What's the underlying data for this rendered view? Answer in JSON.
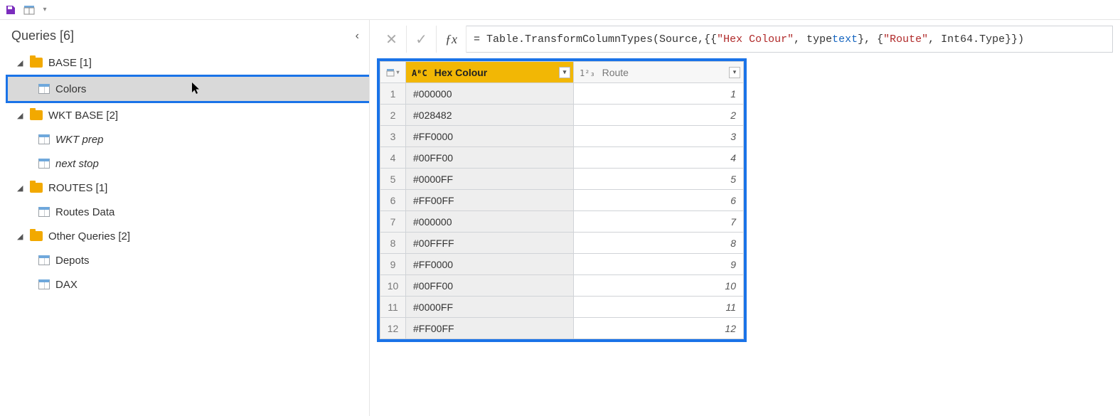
{
  "toolbar": {
    "save_icon": "save-icon",
    "table_icon": "table-icon",
    "dropdown_icon": "chevron-down-icon"
  },
  "sidebar": {
    "header": "Queries [6]",
    "groups": [
      {
        "name": "BASE [1]",
        "expanded": true,
        "items": [
          {
            "name": "Colors",
            "selected": true,
            "italic": false
          }
        ]
      },
      {
        "name": "WKT BASE [2]",
        "expanded": true,
        "items": [
          {
            "name": "WKT prep",
            "selected": false,
            "italic": true
          },
          {
            "name": "next stop",
            "selected": false,
            "italic": true
          }
        ]
      },
      {
        "name": "ROUTES [1]",
        "expanded": true,
        "items": [
          {
            "name": "Routes Data",
            "selected": false,
            "italic": false
          }
        ]
      },
      {
        "name": "Other Queries [2]",
        "expanded": true,
        "items": [
          {
            "name": "Depots",
            "selected": false,
            "italic": false
          },
          {
            "name": "DAX",
            "selected": false,
            "italic": false
          }
        ]
      }
    ]
  },
  "formula": {
    "prefix": "= Table.TransformColumnTypes(Source,{{",
    "str1": "\"Hex Colour\"",
    "mid1": ", type ",
    "kw1": "text",
    "mid2": "}, {",
    "str2": "\"Route\"",
    "mid3": ", Int64.Type}})"
  },
  "table": {
    "columns": [
      {
        "type_badge": "AᴮC",
        "label": "Hex Colour"
      },
      {
        "type_badge": "1²₃",
        "label": "Route"
      }
    ],
    "rows": [
      {
        "idx": "1",
        "hex": "#000000",
        "route": "1"
      },
      {
        "idx": "2",
        "hex": "#028482",
        "route": "2"
      },
      {
        "idx": "3",
        "hex": "#FF0000",
        "route": "3"
      },
      {
        "idx": "4",
        "hex": "#00FF00",
        "route": "4"
      },
      {
        "idx": "5",
        "hex": "#0000FF",
        "route": "5"
      },
      {
        "idx": "6",
        "hex": "#FF00FF",
        "route": "6"
      },
      {
        "idx": "7",
        "hex": "#000000",
        "route": "7"
      },
      {
        "idx": "8",
        "hex": "#00FFFF",
        "route": "8"
      },
      {
        "idx": "9",
        "hex": "#FF0000",
        "route": "9"
      },
      {
        "idx": "10",
        "hex": "#00FF00",
        "route": "10"
      },
      {
        "idx": "11",
        "hex": "#0000FF",
        "route": "11"
      },
      {
        "idx": "12",
        "hex": "#FF00FF",
        "route": "12"
      }
    ]
  }
}
